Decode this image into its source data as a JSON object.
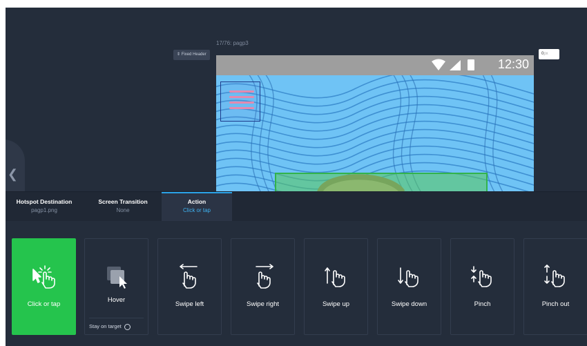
{
  "preview": {
    "screen_counter": "17/76: pagp3",
    "fixed_header_label": "⇕ Fixed Header",
    "offset_value": "0",
    "offset_unit": "px",
    "status_time": "12:30"
  },
  "tabs": [
    {
      "title": "Hotspot Destination",
      "value": "pagp1.png"
    },
    {
      "title": "Screen Transition",
      "value": "None"
    },
    {
      "title": "Action",
      "value": "Click or tap"
    }
  ],
  "actions": [
    {
      "label": "Click or tap",
      "icon": "click-tap-icon",
      "selected": true
    },
    {
      "label": "Hover",
      "icon": "hover-icon",
      "option": "Stay on target"
    },
    {
      "label": "Swipe left",
      "icon": "swipe-left-icon"
    },
    {
      "label": "Swipe right",
      "icon": "swipe-right-icon"
    },
    {
      "label": "Swipe up",
      "icon": "swipe-up-icon"
    },
    {
      "label": "Swipe down",
      "icon": "swipe-down-icon"
    },
    {
      "label": "Pinch",
      "icon": "pinch-icon"
    },
    {
      "label": "Pinch out",
      "icon": "pinch-out-icon"
    }
  ],
  "colors": {
    "background": "#242d3b",
    "selected_action": "#25c44d",
    "accent": "#2ba3e8",
    "pattern_light": "#6fc3f5",
    "pattern_dark": "#2f7fc7"
  }
}
